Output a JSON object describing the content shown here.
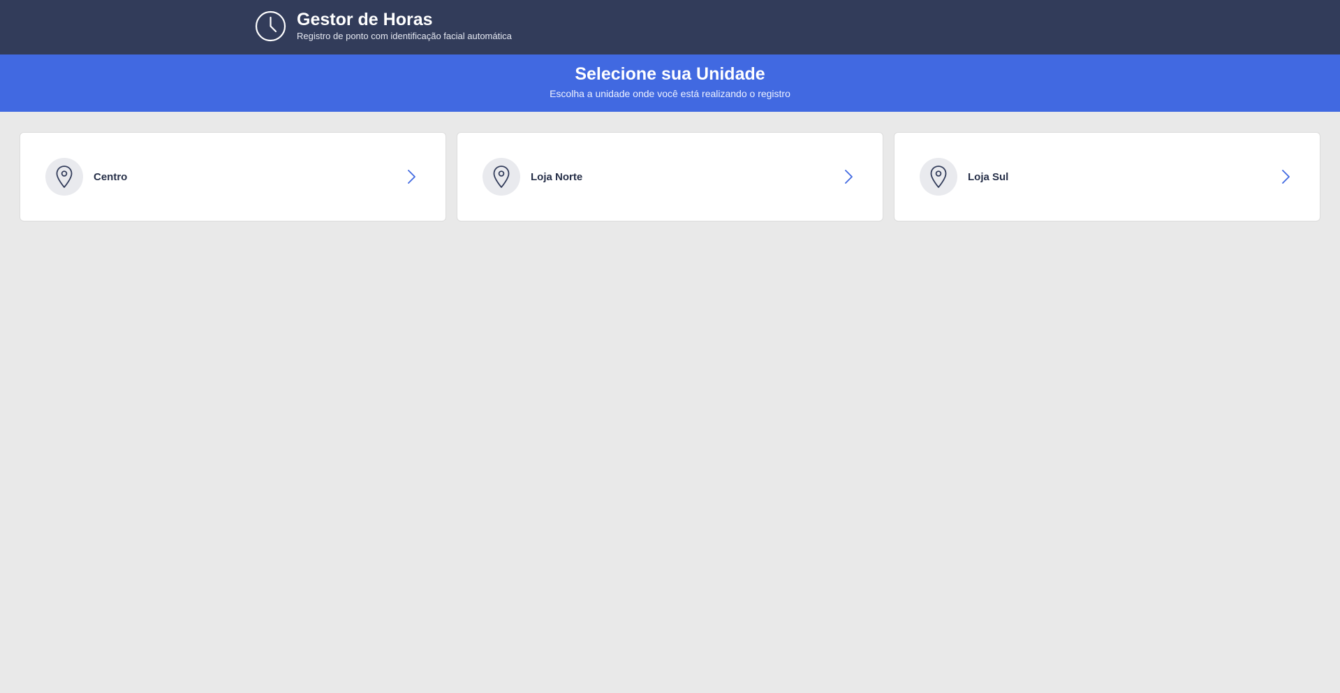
{
  "header": {
    "title": "Gestor de Horas",
    "subtitle": "Registro de ponto com identificação facial automática",
    "icon": "clock-icon"
  },
  "banner": {
    "title": "Selecione sua Unidade",
    "subtitle": "Escolha a unidade onde você está realizando o registro"
  },
  "units": [
    {
      "name": "Centro",
      "icon": "map-pin-icon"
    },
    {
      "name": "Loja Norte",
      "icon": "map-pin-icon"
    },
    {
      "name": "Loja Sul",
      "icon": "map-pin-icon"
    }
  ],
  "colors": {
    "topbar": "#323c5a",
    "banner": "#4169e1",
    "background": "#e9e9e9",
    "card": "#ffffff",
    "text_dark": "#262f48",
    "accent": "#4169e1"
  }
}
